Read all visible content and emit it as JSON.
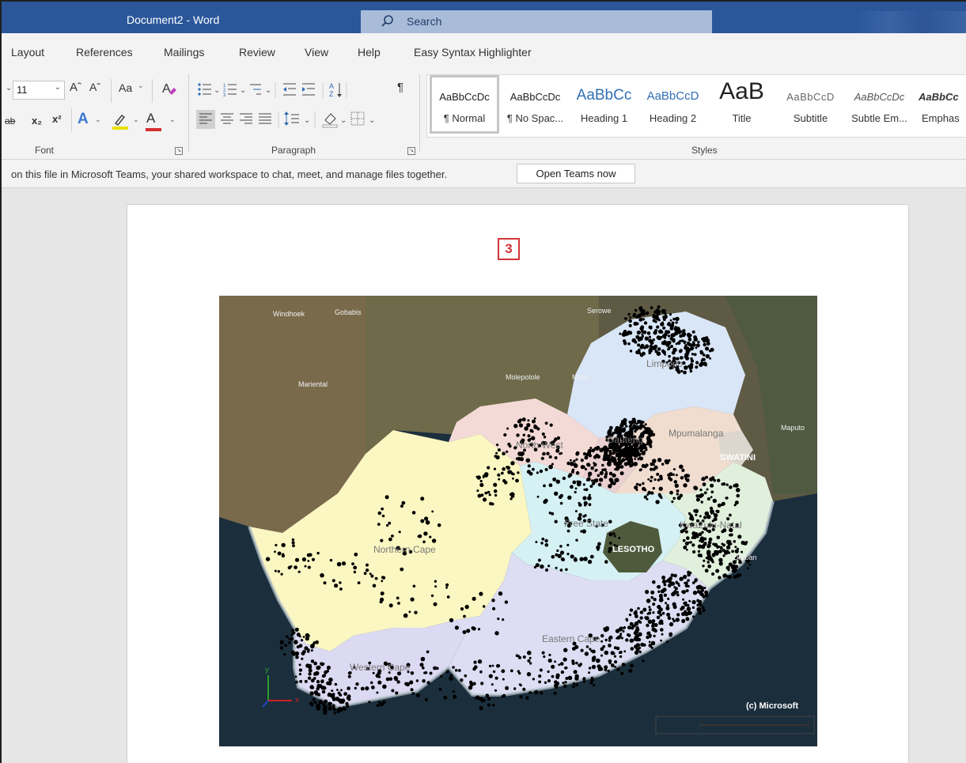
{
  "app": {
    "title": "Document2  -  Word",
    "search_label": "Search"
  },
  "tabs": [
    "Layout",
    "References",
    "Mailings",
    "Review",
    "View",
    "Help",
    "Easy Syntax Highlighter"
  ],
  "ribbon": {
    "font": {
      "size": "11",
      "group_label": "Font",
      "case_label": "Aa",
      "grow_label": "Aˆ",
      "shrink_label": "Aˇ",
      "strike_label": "ab",
      "subscript_label": "x₂",
      "superscript_label": "x²",
      "effects_label": "A",
      "color_label": "A",
      "highlight_color": "#e8e000",
      "font_color": "#d32f2f"
    },
    "paragraph": {
      "group_label": "Paragraph",
      "pilcrow": "¶"
    },
    "styles": {
      "group_label": "Styles",
      "items": [
        {
          "preview": "AaBbCcDc",
          "name": "¶ Normal"
        },
        {
          "preview": "AaBbCcDc",
          "name": "¶ No Spac..."
        },
        {
          "preview": "AaBbCс",
          "name": "Heading 1"
        },
        {
          "preview": "AaBbCcD",
          "name": "Heading 2"
        },
        {
          "preview": "AaB",
          "name": "Title"
        },
        {
          "preview": "AaBbCcD",
          "name": "Subtitle"
        },
        {
          "preview": "AaBbCcDc",
          "name": "Subtle Em..."
        },
        {
          "preview": "AaBbCc",
          "name": "Emphas"
        }
      ]
    }
  },
  "message": {
    "text": "on this file in Microsoft Teams, your shared workspace to chat, meet, and manage files together.",
    "button": "Open Teams now"
  },
  "document": {
    "marker": "3"
  },
  "map": {
    "labels": {
      "windhoek": "Windhoek",
      "gobabis": "Gobabis",
      "serowe": "Serowe",
      "mariental": "Mariental",
      "molepolole": "Molepolole",
      "moch": "Moch",
      "maputo": "Maputo",
      "swatini": "SWATINI",
      "lesotho": "LESOTHO",
      "northern_cape": "Northern Cape",
      "western_cape": "Western Cape",
      "eastern_cape": "Eastern Cape",
      "free_state": "Free State",
      "gauteng": "Gauteng",
      "mpumalanga": "Mpumalanga",
      "kwazulu_natal": "KwaZulu-Natal",
      "north_west": "North West",
      "limpopo": "Limpopo",
      "durban": "Durban",
      "copyright": "(c) Microsoft"
    },
    "axis_x": "x",
    "axis_y": "y",
    "colors": {
      "ocean": "#1b2e3c",
      "northern_cape": "#fbf7c2",
      "western_cape": "#dcd9f3",
      "eastern_cape": "#ddddf3",
      "free_state": "#d5f1f4",
      "north_west": "#f4dad6",
      "limpopo": "#d9e6f7",
      "mpumalanga": "#f0ddd0",
      "kzn": "#e1f0dc",
      "points": "#000000"
    }
  }
}
